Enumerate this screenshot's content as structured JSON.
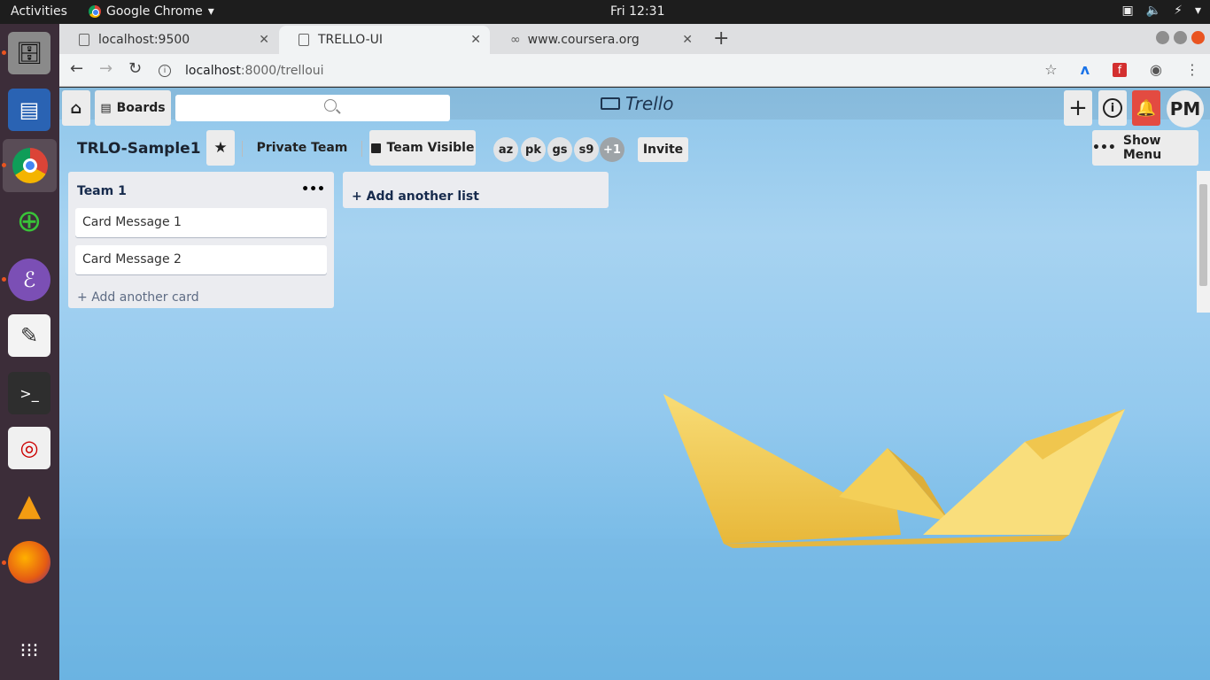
{
  "system": {
    "activities": "Activities",
    "app_name": "Google Chrome",
    "clock": "Fri 12:31"
  },
  "dock": {
    "items": [
      "files-icon",
      "writer-icon",
      "chrome-icon",
      "network-icon",
      "emacs-icon",
      "text-editor-icon",
      "terminal-icon",
      "reader-icon",
      "vlc-icon",
      "firefox-icon",
      "app-grid-icon"
    ]
  },
  "browser": {
    "tabs": [
      {
        "label": "localhost:9500"
      },
      {
        "label": "TRELLO-UI"
      },
      {
        "label": "www.coursera.org"
      }
    ],
    "url_host": "localhost",
    "url_path": ":8000/trelloui"
  },
  "app": {
    "boards_label": "Boards",
    "logo_text": "Trello",
    "avatar_initials": "PM",
    "board": {
      "title": "TRLO-Sample1",
      "team_label": "Private Team",
      "visibility_label": "Team Visible",
      "members": [
        "az",
        "pk",
        "gs",
        "s9"
      ],
      "members_more": "+1",
      "invite_label": "Invite",
      "show_menu_label": "Show Menu"
    },
    "lists": [
      {
        "title": "Team 1",
        "cards": [
          "Card Message 1",
          "Card Message 2"
        ],
        "add_card_label": "Add another card"
      }
    ],
    "add_list_label": "Add another list"
  },
  "colors": {
    "notification_button": "#e34b41",
    "background_sky": "#8fc6ea",
    "boat": "#f6d566"
  }
}
